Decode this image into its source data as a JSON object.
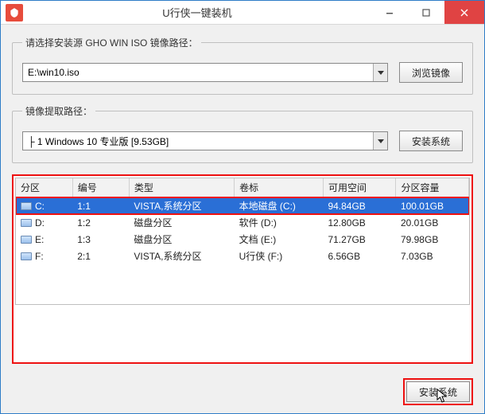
{
  "window": {
    "title": "U行侠一键装机"
  },
  "source": {
    "legend": "请选择安装源 GHO WIN ISO 镜像路径：",
    "path": "E:\\win10.iso",
    "browse_label": "浏览镜像"
  },
  "extract": {
    "legend": "镜像提取路径：",
    "selection": "├ 1 Windows 10 专业版 [9.53GB]",
    "install_label": "安装系统"
  },
  "table": {
    "headers": {
      "drive": "分区",
      "number": "编号",
      "type": "类型",
      "label": "卷标",
      "free": "可用空间",
      "capacity": "分区容量"
    },
    "rows": [
      {
        "drive": "C:",
        "number": "1:1",
        "type": "VISTA,系统分区",
        "label": "本地磁盘 (C:)",
        "free": "94.84GB",
        "capacity": "100.01GB",
        "selected": true
      },
      {
        "drive": "D:",
        "number": "1:2",
        "type": "磁盘分区",
        "label": "软件 (D:)",
        "free": "12.80GB",
        "capacity": "20.01GB",
        "selected": false
      },
      {
        "drive": "E:",
        "number": "1:3",
        "type": "磁盘分区",
        "label": "文档 (E:)",
        "free": "71.27GB",
        "capacity": "79.98GB",
        "selected": false
      },
      {
        "drive": "F:",
        "number": "2:1",
        "type": "VISTA,系统分区",
        "label": "U行侠 (F:)",
        "free": "6.56GB",
        "capacity": "7.03GB",
        "selected": false
      }
    ]
  },
  "footer": {
    "install_label": "安装系统"
  }
}
